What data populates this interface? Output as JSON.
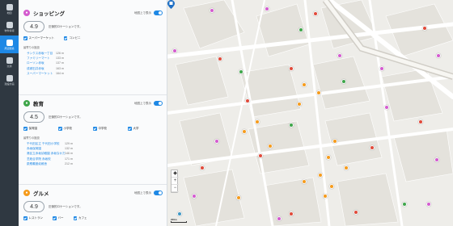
{
  "rail": [
    {
      "label": "地図",
      "active": false
    },
    {
      "label": "物件情報",
      "active": false
    },
    {
      "label": "周辺環境",
      "active": true
    },
    {
      "label": "交通",
      "active": false
    },
    {
      "label": "建設計画",
      "active": false
    }
  ],
  "shopping": {
    "title": "ショッピング",
    "toggle_label": "地図上で表示",
    "score": "4.9",
    "score_desc": "圧倒的ロケーションです。",
    "checks": [
      "スーパーマーケット",
      "コンビニ"
    ],
    "near_title": "最寄りの施設",
    "near": [
      {
        "name": "サンクス赤坂一丁目",
        "dist": "126 m"
      },
      {
        "name": "ファミリーマート",
        "dist": "133 m"
      },
      {
        "name": "ローソン赤坂",
        "dist": "137 m"
      },
      {
        "name": "成城石井赤坂",
        "dist": "163 m"
      },
      {
        "name": "スーパーマーケット",
        "dist": "164 m"
      }
    ]
  },
  "education": {
    "title": "教育",
    "toggle_label": "地図上で表示",
    "score": "4.5",
    "score_desc": "圧倒的ロケーションです。",
    "checks": [
      "保育園",
      "小学校",
      "中学校",
      "大学"
    ],
    "near_title": "最寄りの施設",
    "near": [
      {
        "name": "千代田区立 千代田小学校",
        "dist": "129 m"
      },
      {
        "name": "赤坂保育園",
        "dist": "132 m"
      },
      {
        "name": "港区立赤坂幼稚園 赤坂なかだ",
        "dist": "146 m"
      },
      {
        "name": "芝総合学院 赤坂校",
        "dist": "171 m"
      },
      {
        "name": "慶應義塾幼稚舎",
        "dist": "212 m"
      }
    ]
  },
  "gourmet": {
    "title": "グルメ",
    "toggle_label": "地図上で表示",
    "score": "4.9",
    "score_desc": "圧倒的ロケーションです。",
    "checks": [
      "レストラン",
      "バー",
      "カフェ"
    ]
  },
  "map": {
    "zoom_in": "+",
    "zoom_out": "−",
    "compass": "◆",
    "scale": "200m"
  },
  "colors": {
    "shopping": "#d45bcf",
    "education": "#3fa64a",
    "gourmet": "#f59b1c",
    "accent": "#1e88e5"
  }
}
